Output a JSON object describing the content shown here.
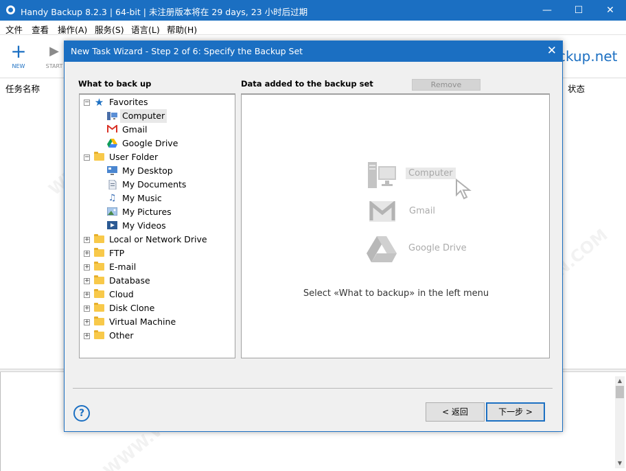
{
  "window": {
    "title": "Handy Backup 8.2.3 | 64-bit | 未注册版本将在 29 days, 23 小时后过期",
    "minimize_glyph": "—",
    "maximize_glyph": "☐",
    "close_glyph": "✕"
  },
  "menu": [
    "文件",
    "查看",
    "操作(A)",
    "服务(S)",
    "语言(L)",
    "帮助(H)"
  ],
  "toolbar": {
    "new_label": "NEW",
    "new_glyph": "+",
    "start_label": "START",
    "start_glyph": "▶"
  },
  "brand_text": "ckup.net",
  "list_header": {
    "name": "任务名称",
    "status": "状态"
  },
  "watermark": "WWW.WEIDOWN.COM",
  "dialog": {
    "title": "New Task Wizard - Step 2 of 6: Specify the Backup Set",
    "close_glyph": "✕",
    "left_label": "What to back up",
    "right_label": "Data added to the backup set",
    "remove_label": "Remove",
    "tree": [
      {
        "label": "Favorites",
        "expander": "−",
        "icon": "star-icon",
        "level": 0
      },
      {
        "label": "Computer",
        "icon": "computer-icon",
        "level": 1,
        "selected": true
      },
      {
        "label": "Gmail",
        "icon": "gmail-icon",
        "level": 1
      },
      {
        "label": "Google Drive",
        "icon": "google-drive-icon",
        "level": 1
      },
      {
        "label": "User Folder",
        "expander": "−",
        "icon": "folder-icon",
        "level": 0
      },
      {
        "label": "My Desktop",
        "icon": "desktop-icon",
        "level": 1
      },
      {
        "label": "My Documents",
        "icon": "document-icon",
        "level": 1
      },
      {
        "label": "My Music",
        "icon": "music-icon",
        "level": 1
      },
      {
        "label": "My Pictures",
        "icon": "picture-icon",
        "level": 1
      },
      {
        "label": "My Videos",
        "icon": "video-icon",
        "level": 1
      },
      {
        "label": "Local or Network Drive",
        "expander": "+",
        "icon": "folder-icon",
        "level": 0
      },
      {
        "label": "FTP",
        "expander": "+",
        "icon": "folder-icon",
        "level": 0
      },
      {
        "label": "E-mail",
        "expander": "+",
        "icon": "folder-icon",
        "level": 0
      },
      {
        "label": "Database",
        "expander": "+",
        "icon": "folder-icon",
        "level": 0
      },
      {
        "label": "Cloud",
        "expander": "+",
        "icon": "folder-icon",
        "level": 0
      },
      {
        "label": "Disk Clone",
        "expander": "+",
        "icon": "folder-icon",
        "level": 0
      },
      {
        "label": "Virtual Machine",
        "expander": "+",
        "icon": "folder-icon",
        "level": 0
      },
      {
        "label": "Other",
        "expander": "+",
        "icon": "folder-icon",
        "level": 0
      }
    ],
    "placeholder_items": [
      "Computer",
      "Gmail",
      "Google Drive"
    ],
    "hint": "Select «What to backup» in the left menu",
    "help_glyph": "?",
    "back_label": "< 返回",
    "next_label": "下一步 >"
  },
  "colors": {
    "accent": "#1b6fc2",
    "folder": "#f8c94a",
    "gmail_red": "#d93025"
  }
}
